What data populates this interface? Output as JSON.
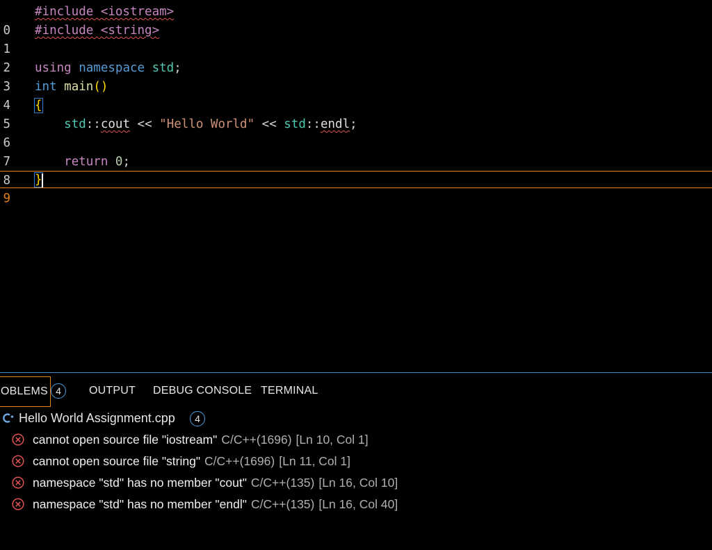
{
  "editor": {
    "lines": [
      {
        "num": "0",
        "current": false
      },
      {
        "num": "1",
        "current": false
      },
      {
        "num": "2",
        "current": false
      },
      {
        "num": "3",
        "current": false
      },
      {
        "num": "4",
        "current": false
      },
      {
        "num": "5",
        "current": false
      },
      {
        "num": "6",
        "current": false
      },
      {
        "num": "7",
        "current": false
      },
      {
        "num": "8",
        "current": false
      },
      {
        "num": "9",
        "current": true
      }
    ],
    "tokens": {
      "include1": "#include <iostream>",
      "include2": "#include <string>",
      "using": "using",
      "namespace": "namespace",
      "std_ns": "std",
      "semi": ";",
      "int": "int",
      "main": "main",
      "parens": "()",
      "open_brace": "{",
      "std1": "std",
      "scope1": "::",
      "cout": "cout",
      "shift1": " << ",
      "hello": "\"Hello World\"",
      "shift2": " << ",
      "std2": "std",
      "scope2": "::",
      "endl": "endl",
      "semi2": ";",
      "return": "return",
      "zero": "0",
      "semi3": ";",
      "close_brace": "}"
    }
  },
  "panel": {
    "tabs": {
      "problems": "OBLEMS",
      "problems_count": "4",
      "output": "OUTPUT",
      "debug_console": "DEBUG CONSOLE",
      "terminal": "TERMINAL"
    },
    "file": {
      "icon": "C",
      "name": "Hello World Assignment.cpp",
      "count": "4"
    },
    "problems": [
      {
        "message": "cannot open source file \"iostream\"",
        "source": "C/C++(1696)",
        "position": "[Ln 10, Col 1]"
      },
      {
        "message": "cannot open source file \"string\"",
        "source": "C/C++(1696)",
        "position": "[Ln 11, Col 1]"
      },
      {
        "message": "namespace \"std\" has no member \"cout\"",
        "source": "C/C++(135)",
        "position": "[Ln 16, Col 10]"
      },
      {
        "message": "namespace \"std\" has no member \"endl\"",
        "source": "C/C++(135)",
        "position": "[Ln 16, Col 40]"
      }
    ]
  },
  "colors": {
    "background": "#000000",
    "accent_orange": "#e0821f",
    "accent_blue": "#3f8ccc",
    "error_red": "#e05252"
  },
  "icons": {
    "file_type": "cpp-file-icon",
    "problem": "error-circle-x-icon"
  }
}
